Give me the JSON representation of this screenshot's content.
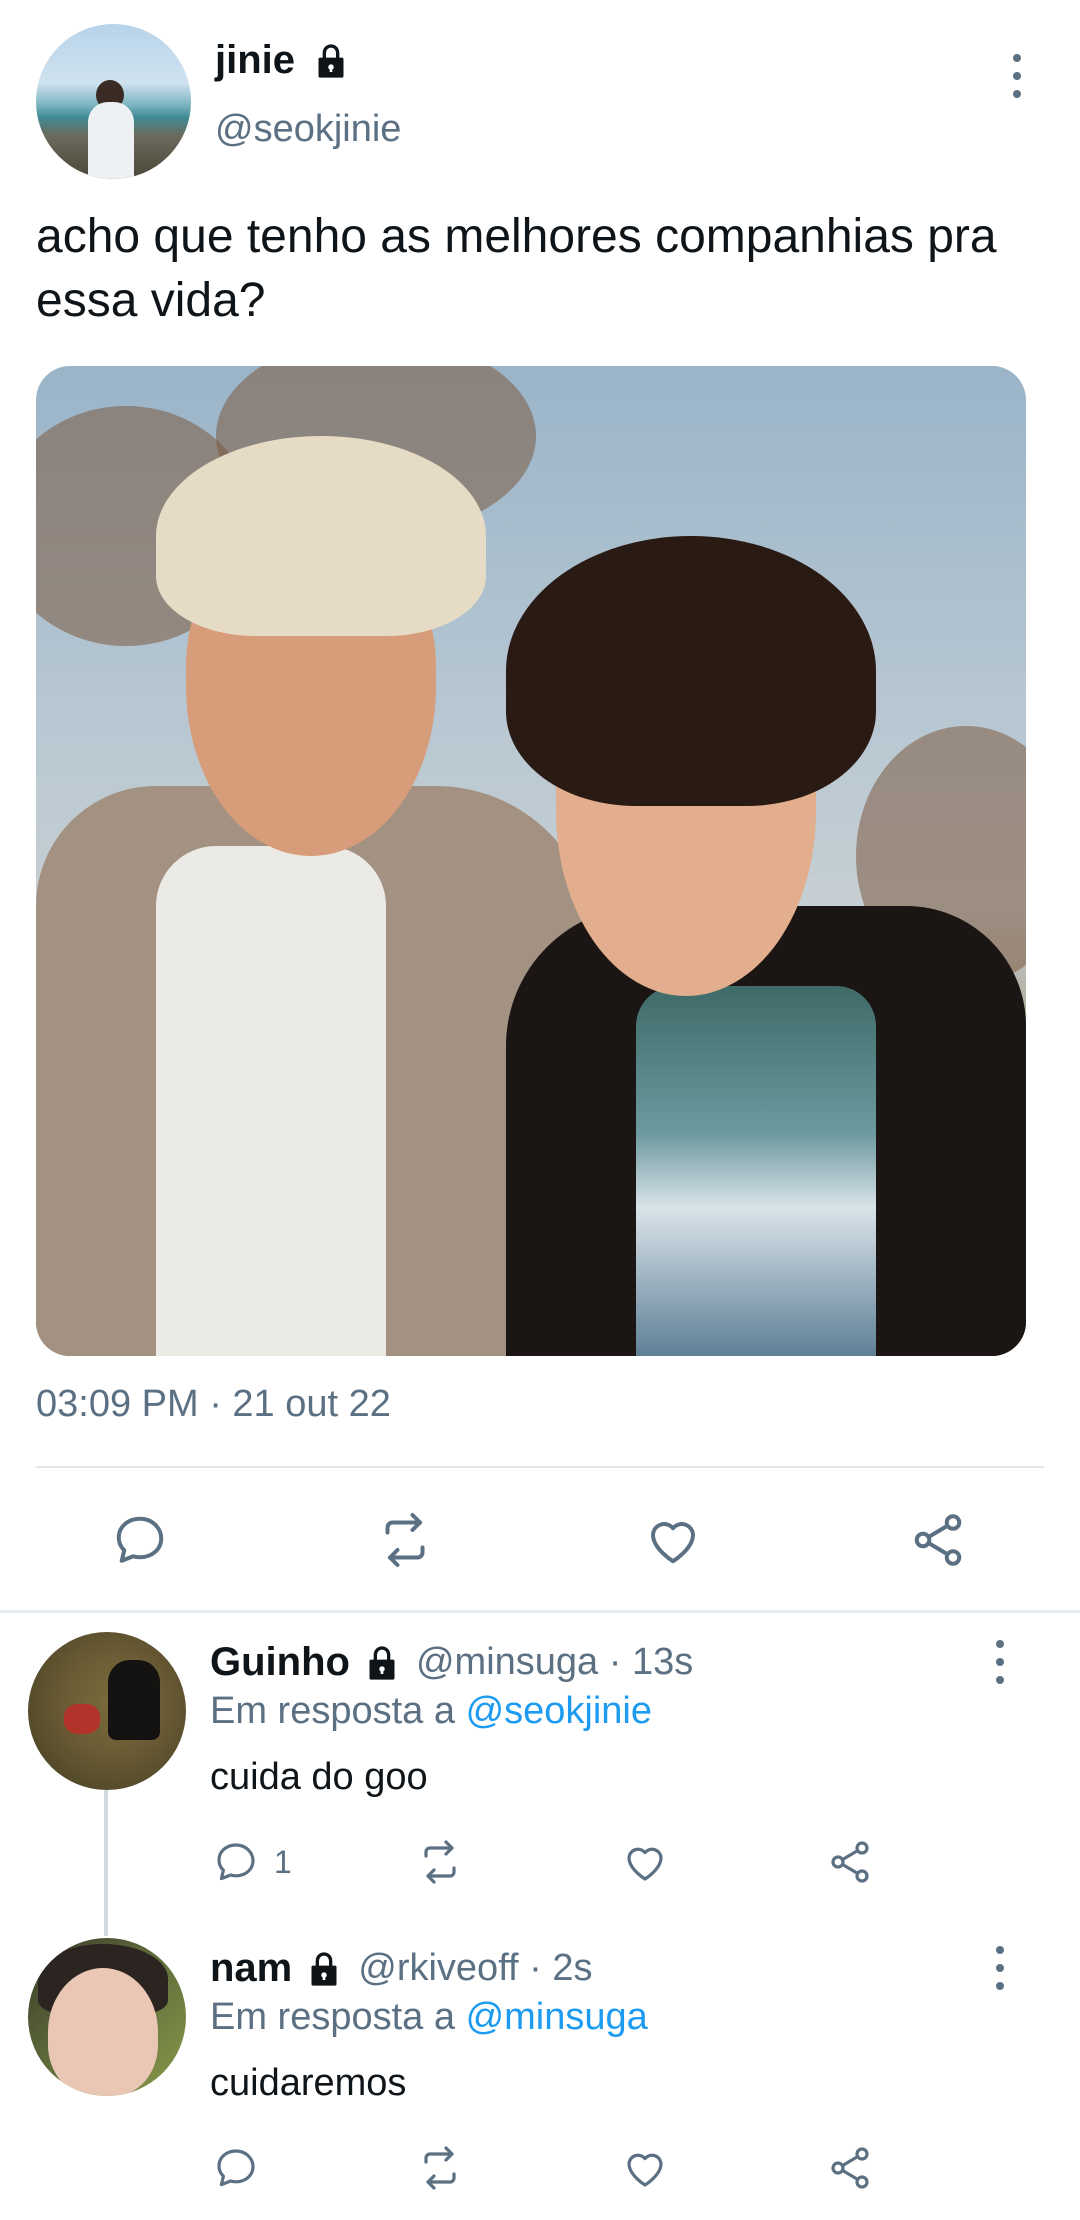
{
  "main_tweet": {
    "author_name": "jinie",
    "author_handle": "@seokjinie",
    "text": "acho que tenho as melhores companhias pra essa vida?",
    "timestamp": "03:09 PM · 21 out 22"
  },
  "replies": [
    {
      "name": "Guinho",
      "handle_time": "@minsuga · 13s",
      "reply_to_prefix": "Em resposta a",
      "reply_to_mention": "@seokjinie",
      "text": "cuida do goo",
      "reply_count": "1"
    },
    {
      "name": "nam",
      "handle_time": "@rkiveoff · 2s",
      "reply_to_prefix": "Em resposta a",
      "reply_to_mention": "@minsuga",
      "text": "cuidaremos",
      "reply_count": ""
    }
  ],
  "colors": {
    "text_primary": "#0f1419",
    "text_secondary": "#5b7083",
    "mention": "#1d9bf0",
    "divider": "#e1e8ed"
  },
  "icons": [
    "lock-icon",
    "more-icon",
    "reply-icon",
    "retweet-icon",
    "like-icon",
    "share-icon"
  ]
}
